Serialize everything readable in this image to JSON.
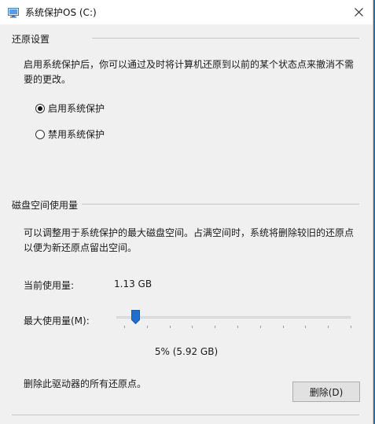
{
  "window": {
    "title": "系统保护OS (C:)",
    "close_symbol": "✕"
  },
  "restore_settings": {
    "header": "还原设置",
    "description": "启用系统保护后，你可以通过及时将计算机还原到以前的某个状态点来撤消不需要的更改。",
    "options": [
      {
        "label": "启用系统保护",
        "selected": true
      },
      {
        "label": "禁用系统保护",
        "selected": false
      }
    ]
  },
  "disk_usage": {
    "header": "磁盘空间使用量",
    "description": "可以调整用于系统保护的最大磁盘空间。占满空间时，系统将删除较旧的还原点以便为新还原点留出空间。",
    "current_label": "当前使用量:",
    "current_value": "1.13 GB",
    "max_label": "最大使用量(M):",
    "max_fraction": 0.05,
    "max_text": "5% (5.92 GB)"
  },
  "delete_section": {
    "description": "删除此驱动器的所有还原点。",
    "button_label": "删除(D)"
  },
  "colors": {
    "slider_thumb": "#1e6fd0",
    "background": "#f0f0f0",
    "desktop": "#1f6fb5"
  },
  "icons": {
    "app": "system-protection-icon",
    "close": "close-icon"
  }
}
